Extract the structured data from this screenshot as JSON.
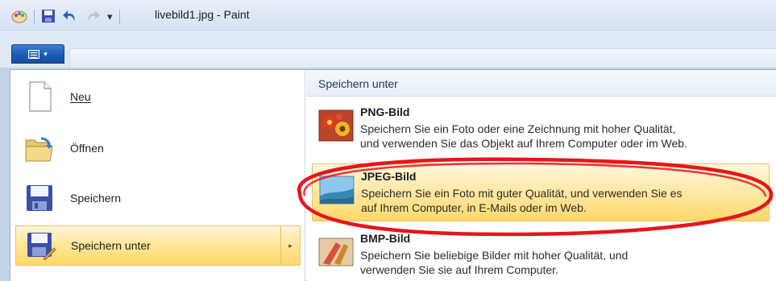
{
  "window": {
    "title": "livebild1.jpg - Paint"
  },
  "quick_access": {
    "icons": [
      "paint-app-icon",
      "save-icon",
      "undo-icon",
      "redo-icon",
      "customize-qat-icon"
    ],
    "dropdown_glyph": "▾"
  },
  "ribbon": {
    "app_button_glyph": "▾"
  },
  "menu": {
    "items": [
      {
        "label": "Neu",
        "icon": "new-document-icon"
      },
      {
        "label": "Öffnen",
        "icon": "open-folder-icon"
      },
      {
        "label": "Speichern",
        "icon": "save-icon"
      },
      {
        "label": "Speichern unter",
        "icon": "save-as-icon",
        "arrow": "▸"
      }
    ]
  },
  "submenu": {
    "heading": "Speichern unter",
    "items": [
      {
        "title": "PNG-Bild",
        "line1": "Speichern Sie ein Foto oder eine Zeichnung mit hoher Qualität,",
        "line2": "und verwenden Sie das Objekt auf Ihrem Computer oder im Web.",
        "icon": "png-image-icon"
      },
      {
        "title": "JPEG-Bild",
        "line1": "Speichern Sie ein Foto mit guter Qualität, und verwenden Sie es",
        "line2": "auf Ihrem Computer, in E-Mails oder im Web.",
        "icon": "jpeg-image-icon"
      },
      {
        "title": "BMP-Bild",
        "line1": "Speichern Sie beliebige Bilder mit hoher Qualität, und",
        "line2": "verwenden Sie sie auf Ihrem Computer.",
        "icon": "bmp-image-icon"
      }
    ]
  },
  "colors": {
    "highlight_ellipse": "#e8141c",
    "hover_fill": "#ffe08a",
    "app_button": "#2563c4"
  }
}
